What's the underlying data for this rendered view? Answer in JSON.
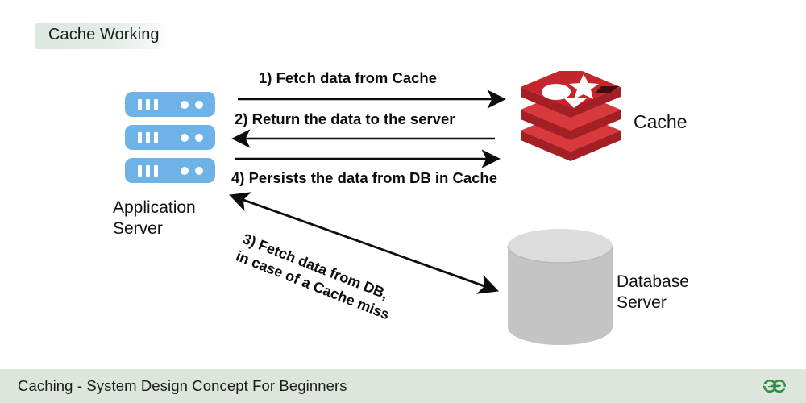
{
  "title": {
    "text": "Cache Working"
  },
  "nodes": {
    "app_server": {
      "label": "Application\nServer",
      "icon": "server-stack-icon",
      "color": "#6db3e8",
      "units": 3
    },
    "cache": {
      "label": "Cache",
      "icon": "redis-cache-icon",
      "color": "#c0262a"
    },
    "database": {
      "label": "Database\nServer",
      "icon": "database-cylinder-icon",
      "color": "#c4c4c4"
    }
  },
  "flows": [
    {
      "step": "1",
      "caption": "1) Fetch data from Cache",
      "direction": "right",
      "from": "app_server",
      "to": "cache"
    },
    {
      "step": "2",
      "caption": "2) Return the data to the server",
      "direction": "left",
      "from": "cache",
      "to": "app_server"
    },
    {
      "step": "3",
      "caption_line1": "3) Fetch data from DB,",
      "caption_line2": "in case of a Cache miss",
      "direction": "both",
      "from": "app_server",
      "to": "database"
    },
    {
      "step": "4",
      "caption": "4) Persists the data from DB in Cache",
      "direction": "right",
      "from": "app_server",
      "to": "cache"
    }
  ],
  "footer": {
    "text": "Caching - System Design Concept For Beginners",
    "logo": "geeksforgeeks-logo",
    "logo_color": "#2f8d46",
    "background": "#dde5dd"
  }
}
